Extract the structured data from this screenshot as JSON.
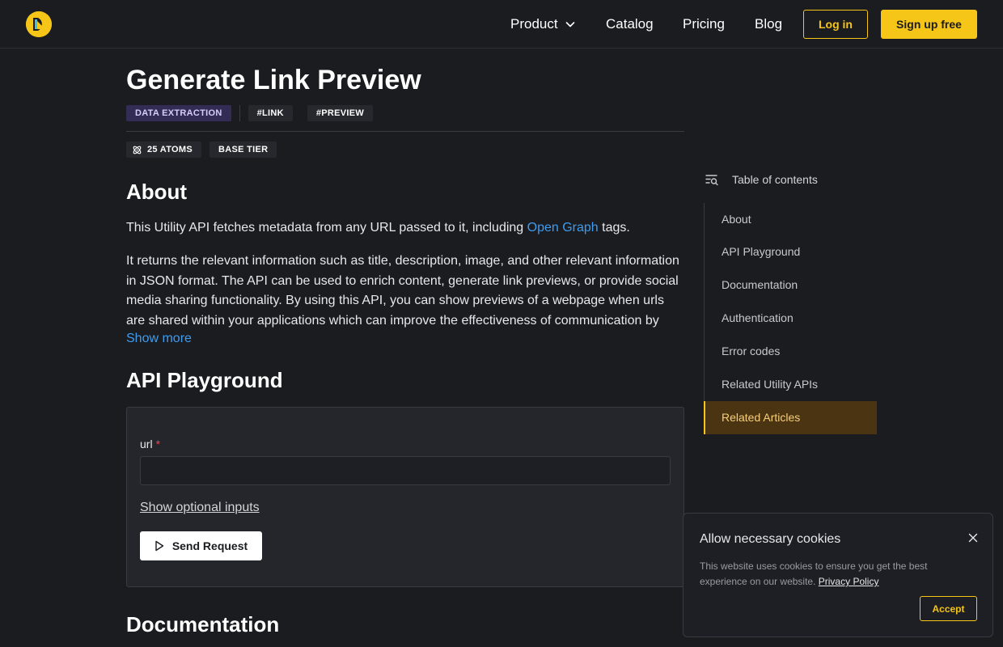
{
  "header": {
    "nav": {
      "product": "Product",
      "catalog": "Catalog",
      "pricing": "Pricing",
      "blog": "Blog"
    },
    "login": "Log in",
    "signup": "Sign up free"
  },
  "page": {
    "title": "Generate Link Preview",
    "category_tag": "DATA EXTRACTION",
    "tags": [
      "#LINK",
      "#PREVIEW"
    ],
    "atoms": "25 ATOMS",
    "tier": "BASE TIER"
  },
  "about": {
    "heading": "About",
    "p1_before": "This Utility API fetches metadata from any URL passed to it, including ",
    "p1_link": "Open Graph",
    "p1_after": " tags.",
    "p2": "It returns the relevant information such as title, description, image, and other relevant information in JSON format. The API can be used to enrich content, generate link previews, or provide social media sharing functionality. By using this API, you can show previews of a webpage when urls are shared within your applications which can improve the effectiveness of communication by",
    "show_more": "Show more"
  },
  "playground": {
    "heading": "API Playground",
    "field_label": "url",
    "required_mark": "*",
    "input_value": "",
    "optional_link": "Show optional inputs",
    "send_button": "Send Request"
  },
  "documentation": {
    "heading": "Documentation"
  },
  "toc": {
    "heading": "Table of contents",
    "items": [
      "About",
      "API Playground",
      "Documentation",
      "Authentication",
      "Error codes",
      "Related Utility APIs",
      "Related Articles"
    ],
    "active_index": 6
  },
  "cookie": {
    "title": "Allow necessary cookies",
    "text": "This website uses cookies to ensure you get the best experience on our website. ",
    "policy_link": "Privacy Policy",
    "accept": "Accept"
  },
  "colors": {
    "accent": "#f5c518",
    "link": "#3d9cf0",
    "background": "#1b1c20"
  }
}
